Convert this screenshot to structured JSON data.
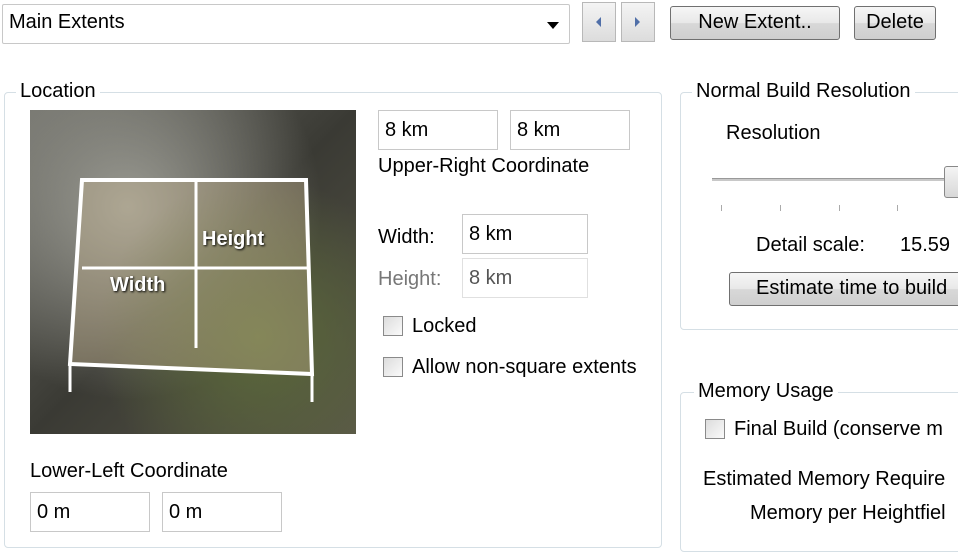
{
  "top": {
    "extent_select": "Main Extents",
    "prev_icon": "triangle-left-icon",
    "next_icon": "triangle-right-icon",
    "new_extent": "New Extent..",
    "delete": "Delete"
  },
  "location": {
    "title": "Location",
    "image_labels": {
      "height": "Height",
      "width": "Width"
    },
    "upper_right_x": "8 km",
    "upper_right_y": "8 km",
    "upper_right_label": "Upper-Right Coordinate",
    "width_label": "Width:",
    "width_value": "8 km",
    "height_label": "Height:",
    "height_value": "8 km",
    "locked": "Locked",
    "locked_checked": false,
    "allow_non_square": "Allow non-square extents",
    "allow_non_square_checked": false,
    "lower_left_label": "Lower-Left Coordinate",
    "lower_left_x": "0 m",
    "lower_left_y": "0 m"
  },
  "resolution": {
    "title": "Normal Build Resolution",
    "label": "Resolution",
    "slider_value_percent": 100,
    "detail_label": "Detail scale:",
    "detail_value": "15.59",
    "estimate": "Estimate time to build"
  },
  "memory": {
    "title": "Memory Usage",
    "final_build": "Final Build (conserve m",
    "final_build_checked": false,
    "estimated": "Estimated Memory Require",
    "per_heightfield": "Memory per Heightfiel"
  }
}
